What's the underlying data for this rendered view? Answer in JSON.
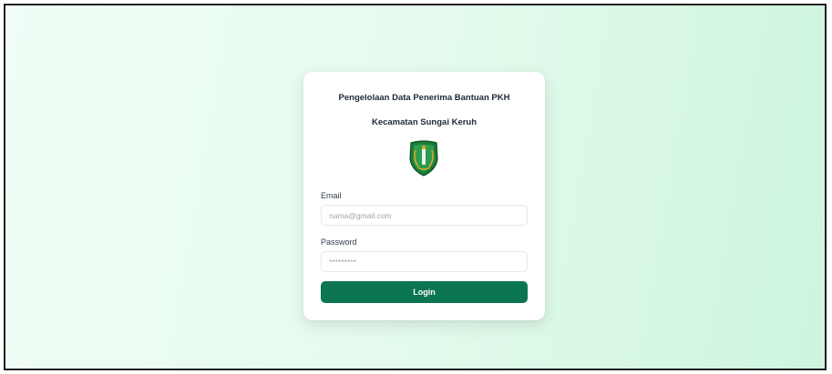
{
  "login_card": {
    "title_line1": "Pengelolaan Data Penerima Bantuan PKH",
    "title_line2": "Kecamatan Sungai Keruh",
    "logo_icon": "regional-emblem-shield-icon",
    "email": {
      "label": "Email",
      "placeholder": "nama@gmail.com",
      "value": ""
    },
    "password": {
      "label": "Password",
      "placeholder": "*********",
      "value": ""
    },
    "login_button_label": "Login"
  },
  "colors": {
    "primary_button": "#0b7650",
    "background_start": "#f1fdf6",
    "background_end": "#cdf5de",
    "emblem_green": "#1a7a3a",
    "emblem_gold": "#d4a82a"
  }
}
